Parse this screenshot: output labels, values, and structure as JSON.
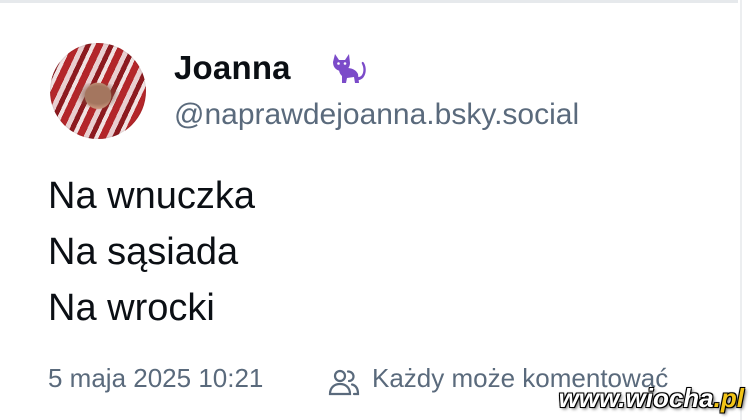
{
  "post": {
    "author": {
      "display_name": "Joanna",
      "handle": "@naprawdejoanna.bsky.social",
      "badge_icon": "cat-icon",
      "badge_color": "#7b4bc9"
    },
    "text_lines": [
      "Na wnuczka",
      "Na sąsiada",
      "Na wrocki"
    ],
    "timestamp": "5 maja 2025 10:21",
    "reply_setting": {
      "icon": "people-icon",
      "label": "Każdy może komentować"
    }
  },
  "watermark": {
    "prefix": "www.",
    "brand": "wiocha",
    "suffix": ".pl"
  },
  "colors": {
    "text_primary": "#0b0f14",
    "text_secondary": "#5a6a7c",
    "background": "#ffffff"
  }
}
